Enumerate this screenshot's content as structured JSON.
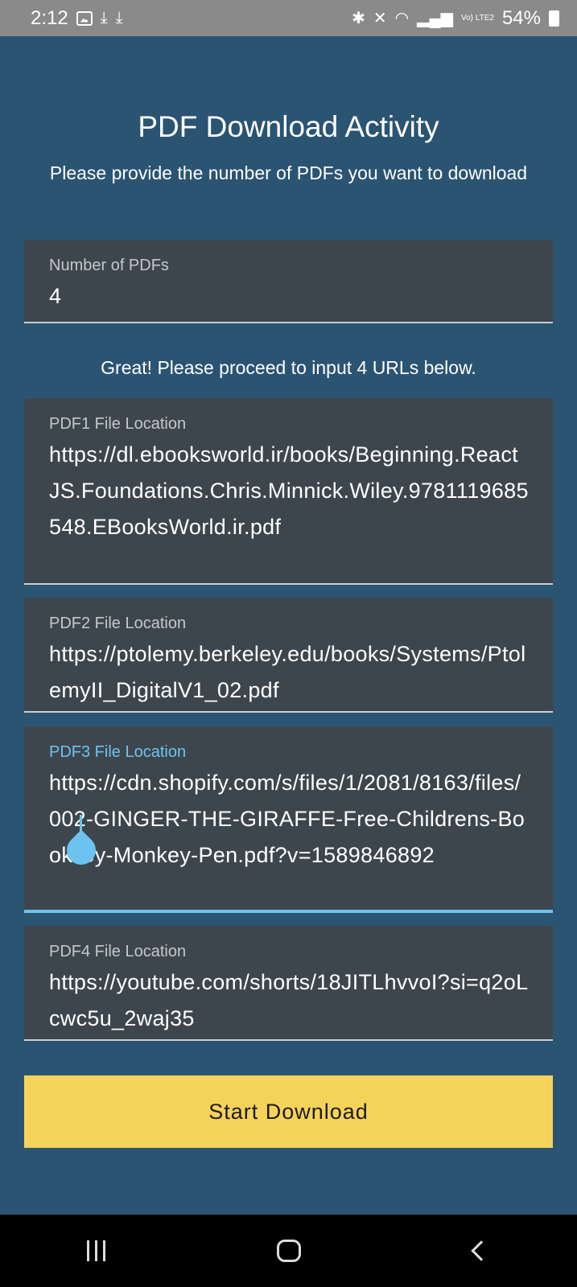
{
  "status_bar": {
    "time": "2:12",
    "network": "Vo) LTE2",
    "battery": "54%"
  },
  "page": {
    "title": "PDF Download Activity",
    "subtitle": "Please provide the number of PDFs you want to download",
    "helper": "Great! Please proceed to input 4 URLs below.",
    "start_button": "Start Download"
  },
  "count_field": {
    "label": "Number of PDFs",
    "value": "4"
  },
  "pdf_fields": [
    {
      "label": "PDF1 File Location",
      "value": "https://dl.ebooksworld.ir/books/Beginning.ReactJS.Foundations.Chris.Minnick.Wiley.9781119685548.EBooksWorld.ir.pdf"
    },
    {
      "label": "PDF2 File Location",
      "value": "https://ptolemy.berkeley.edu/books/Systems/PtolemyII_DigitalV1_02.pdf"
    },
    {
      "label": "PDF3 File Location",
      "value": "https://cdn.shopify.com/s/files/1/2081/8163/files/002-GINGER-THE-GIRAFFE-Free-Childrens-Book-By-Monkey-Pen.pdf?v=1589846892"
    },
    {
      "label": "PDF4 File Location",
      "value": "https://youtube.com/shorts/18JITLhvvoI?si=q2oLcwc5u_2waj35"
    }
  ],
  "colors": {
    "background": "#2b5472",
    "field": "#3e464d",
    "accent": "#6cc3f0",
    "button": "#f5d35a"
  }
}
